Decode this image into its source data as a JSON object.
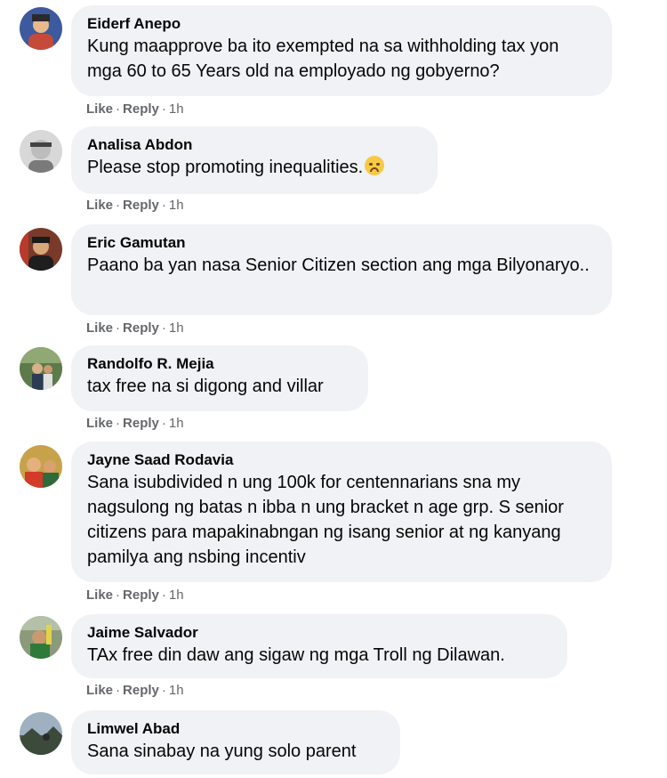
{
  "comments": [
    {
      "author": "Eiderf Anepo",
      "text": "Kung maapprove ba ito exempted na sa withholding tax yon mga 60 to 65 Years old na employado ng gobyerno?",
      "like": "Like",
      "reply": "Reply",
      "time": "1h",
      "avatar": "profile-photo"
    },
    {
      "author": "Analisa Abdon",
      "text": "Please stop promoting inequalities.",
      "emoji": "sad-face-emoji",
      "like": "Like",
      "reply": "Reply",
      "time": "1h",
      "avatar": "profile-photo"
    },
    {
      "author": "Eric Gamutan",
      "text": "Paano ba yan nasa Senior Citizen section ang mga Bilyonaryo..",
      "like": "Like",
      "reply": "Reply",
      "time": "1h",
      "avatar": "profile-photo"
    },
    {
      "author": "Randolfo R. Mejia",
      "text": "tax free na si digong and villar",
      "like": "Like",
      "reply": "Reply",
      "time": "1h",
      "avatar": "profile-photo"
    },
    {
      "author": "Jayne Saad Rodavia",
      "text": "Sana isubdivided n ung 100k for centennarians sna my nagsulong ng batas n ibba n ung bracket n age grp. S senior citizens para mapakinabngan ng isang senior at ng kanyang pamilya ang nsbing incentiv",
      "like": "Like",
      "reply": "Reply",
      "time": "1h",
      "avatar": "profile-photo"
    },
    {
      "author": "Jaime Salvador",
      "text": "TAx free din daw ang sigaw ng mga Troll ng Dilawan.",
      "like": "Like",
      "reply": "Reply",
      "time": "1h",
      "avatar": "profile-photo"
    },
    {
      "author": "Limwel Abad",
      "text": "Sana sinabay na yung solo parent",
      "avatar": "profile-photo"
    }
  ],
  "colors": {
    "bubble": "#f0f2f5",
    "author": "#050505",
    "meta": "#65676b"
  }
}
